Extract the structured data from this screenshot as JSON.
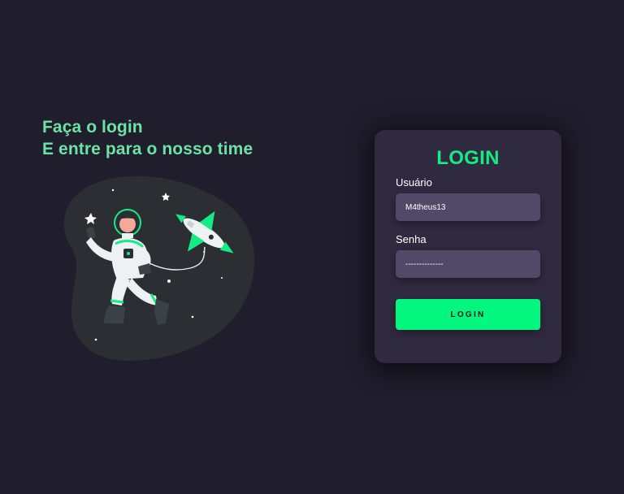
{
  "hero": {
    "line1": "Faça o login",
    "line2": "E entre para o nosso time",
    "illustration_icon": "astronaut-with-rocket-illustration"
  },
  "login_card": {
    "title": "LOGIN",
    "username_label": "Usuário",
    "username_value": "M4theus13",
    "password_label": "Senha",
    "password_mask": "--------------",
    "submit_label": "LOGIN"
  },
  "colors": {
    "background": "#201d2c",
    "card": "#2f2a3f",
    "field": "#524868",
    "accent_green": "#03f77e",
    "headline_green": "#6ce3a6"
  }
}
